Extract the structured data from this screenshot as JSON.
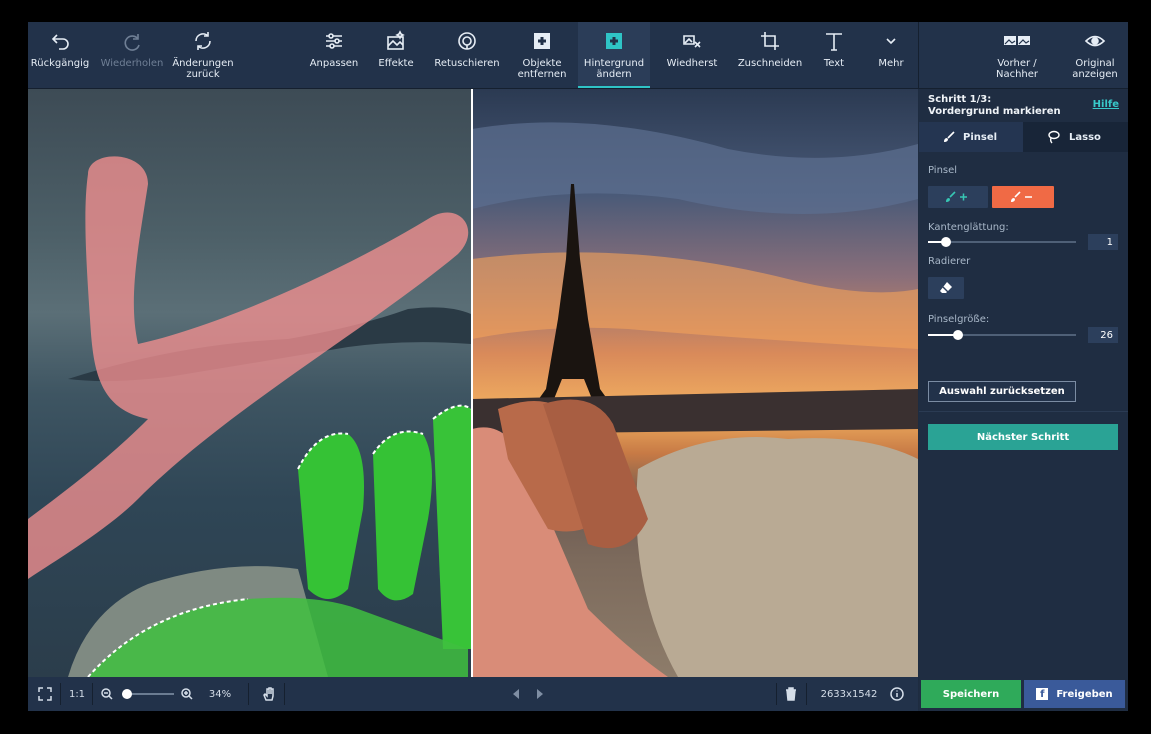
{
  "toolbar": {
    "undo": "Rückgängig",
    "redo": "Wiederholen",
    "revert": "Änderungen zurück",
    "adjust": "Anpassen",
    "effects": "Effekte",
    "retouch": "Retuschieren",
    "remove_objects": "Objekte entfernen",
    "change_bg": "Hintergrund ändern",
    "restore": "Wiedherst",
    "crop": "Zuschneiden",
    "text": "Text",
    "more": "Mehr",
    "before_after": "Vorher / Nachher",
    "show_original": "Original anzeigen"
  },
  "panel": {
    "step_line1": "Schritt 1/3:",
    "step_line2": "Vordergrund markieren",
    "help": "Hilfe",
    "tab_brush": "Pinsel",
    "tab_lasso": "Lasso",
    "brush_label": "Pinsel",
    "smoothing_label": "Kantenglättung:",
    "smoothing_value": "1",
    "eraser_label": "Radierer",
    "brush_size_label": "Pinselgröße:",
    "brush_size_value": "26",
    "reset_selection": "Auswahl zurücksetzen",
    "next_step": "Nächster Schritt"
  },
  "bottombar": {
    "one_to_one": "1:1",
    "zoom": "34%",
    "dimensions": "2633x1542",
    "save": "Speichern",
    "share": "Freigeben"
  },
  "colors": {
    "accent_teal": "#2fc4c6",
    "save_green": "#2faa5a",
    "share_blue": "#3a5a9a",
    "remove_brush": "#f06a45",
    "foreground_mark": "#3ec63e",
    "background_mark": "#f08a8a"
  },
  "sliders": {
    "smoothing_fraction": 0.12,
    "brush_size_fraction": 0.2
  }
}
